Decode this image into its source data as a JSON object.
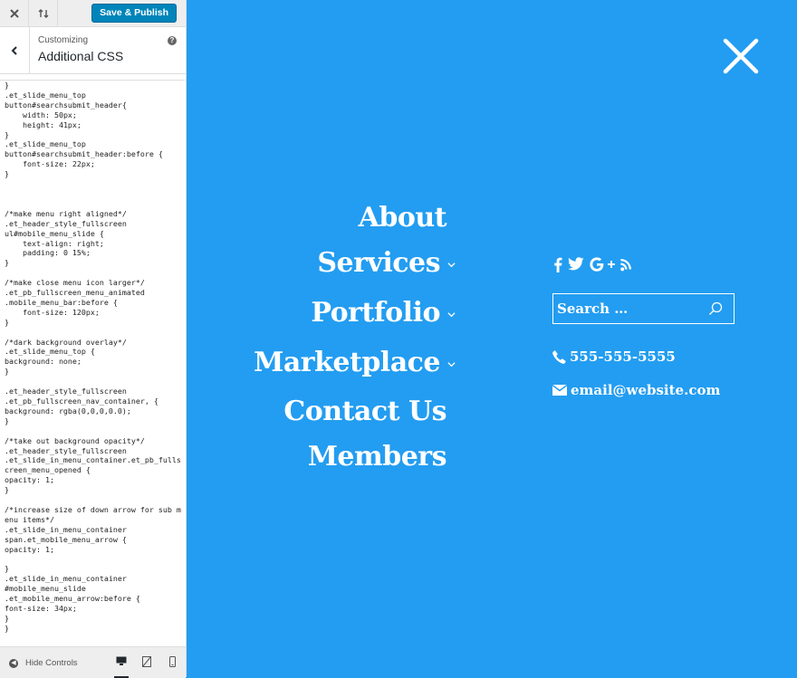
{
  "customizer": {
    "close_icon": "close-icon",
    "reorder_icon": "reorder-icon",
    "save_label": "Save & Publish",
    "breadcrumb_small": "Customizing",
    "section_title": "Additional CSS",
    "help_icon": "help-icon",
    "css_code": "}\n.et_slide_menu_top\nbutton#searchsubmit_header{\n    width: 50px;\n    height: 41px;\n}\n.et_slide_menu_top\nbutton#searchsubmit_header:before {\n    font-size: 22px;\n}\n\n\n\n/*make menu right aligned*/\n.et_header_style_fullscreen\nul#mobile_menu_slide {\n    text-align: right;\n    padding: 0 15%;\n}\n\n/*make close menu icon larger*/\n.et_pb_fullscreen_menu_animated\n.mobile_menu_bar:before {\n    font-size: 120px;\n}\n\n/*dark background overlay*/\n.et_slide_menu_top {\nbackground: none;\n}\n\n.et_header_style_fullscreen\n.et_pb_fullscreen_nav_container, {\nbackground: rgba(0,0,0,0.0);\n}\n\n/*take out background opacity*/\n.et_header_style_fullscreen\n.et_slide_in_menu_container.et_pb_fullscreen_menu_opened {\nopacity: 1;\n}\n\n/*increase size of down arrow for sub menu items*/\n.et_slide_in_menu_container\nspan.et_mobile_menu_arrow {\nopacity: 1;\n\n}\n.et_slide_in_menu_container\n#mobile_menu_slide\n.et_mobile_menu_arrow:before {\nfont-size: 34px;\n}\n}",
    "hide_controls_label": "Hide Controls",
    "devices": [
      "desktop-icon",
      "tablet-icon",
      "mobile-icon"
    ]
  },
  "preview": {
    "background": "#239df1",
    "menu": [
      {
        "label": "About",
        "has_submenu": false
      },
      {
        "label": "Services",
        "has_submenu": true
      },
      {
        "label": "Portfolio",
        "has_submenu": true
      },
      {
        "label": "Marketplace",
        "has_submenu": true
      },
      {
        "label": "Contact Us",
        "has_submenu": false
      },
      {
        "label": "Members",
        "has_submenu": false
      }
    ],
    "social_icons": [
      "facebook-icon",
      "twitter-icon",
      "google-plus-icon",
      "rss-icon"
    ],
    "search_placeholder": "Search …",
    "phone": "555-555-5555",
    "email": "email@website.com"
  }
}
